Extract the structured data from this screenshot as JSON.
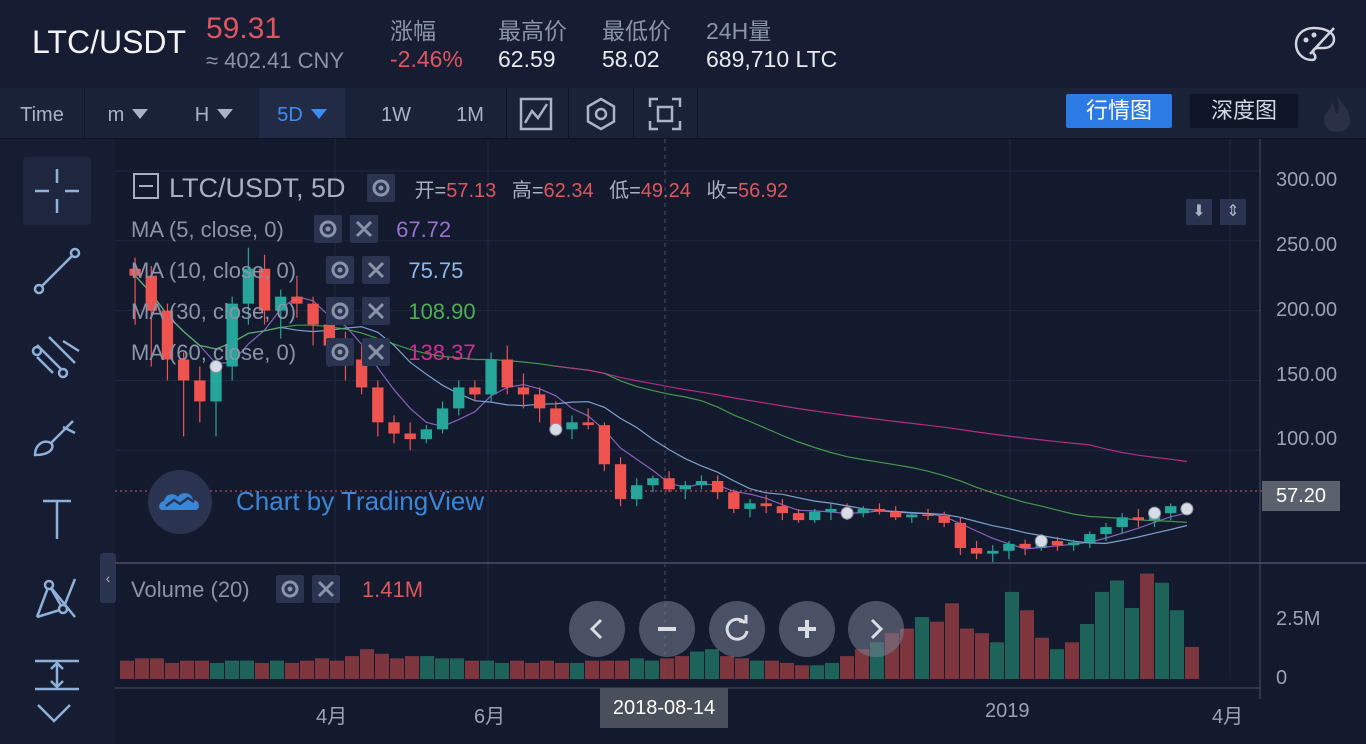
{
  "header": {
    "pair": "LTC/USDT",
    "price": "59.31",
    "price_cny": "≈ 402.41 CNY",
    "stats": [
      {
        "label": "涨幅",
        "value": "-2.46%"
      },
      {
        "label": "最高价",
        "value": "62.59"
      },
      {
        "label": "最低价",
        "value": "58.02"
      },
      {
        "label": "24H量",
        "value": "689,710 LTC"
      }
    ],
    "theme_icon": "palette-icon"
  },
  "toolbar": {
    "time_label": "Time",
    "intervals": [
      "m",
      "H",
      "5D",
      "1W",
      "1M"
    ],
    "active_interval": "5D",
    "icons": [
      "indicator-icon",
      "settings-hex-icon",
      "screenshot-icon"
    ],
    "market_tab": "行情图",
    "depth_tab": "深度图"
  },
  "legend": {
    "title": "LTC/USDT, 5D",
    "ohlc": [
      {
        "label": "开=",
        "value": "57.13"
      },
      {
        "label": "高=",
        "value": "62.34"
      },
      {
        "label": "低=",
        "value": "49.24"
      },
      {
        "label": "收=",
        "value": "56.92"
      }
    ],
    "ma": [
      {
        "label": "MA (5, close, 0)",
        "value": "67.72",
        "color": "#9b6fd1"
      },
      {
        "label": "MA (10, close, 0)",
        "value": "75.75",
        "color": "#8fb8e8"
      },
      {
        "label": "MA (30, close, 0)",
        "value": "108.90",
        "color": "#4caf50"
      },
      {
        "label": "MA (60, close, 0)",
        "value": "138.37",
        "color": "#d12f8f"
      }
    ],
    "volume": {
      "label": "Volume (20)",
      "value": "1.41M"
    }
  },
  "watermark": "Chart by TradingView",
  "price_axis": [
    "300.00",
    "250.00",
    "200.00",
    "150.00",
    "100.00"
  ],
  "current_price_tag": "57.20",
  "volume_axis": [
    "2.5M",
    "0"
  ],
  "time_axis": [
    "4月",
    "6月",
    "2019",
    "4月"
  ],
  "crosshair_date": "2018-08-14",
  "left_tools": [
    "crosshair-icon",
    "trend-line-icon",
    "pitchfork-icon",
    "brush-icon",
    "text-icon",
    "pattern-icon",
    "measure-icon"
  ],
  "nav_buttons": [
    "chevron-left-icon",
    "zoom-out-icon",
    "reset-icon",
    "zoom-in-icon",
    "chevron-right-icon"
  ],
  "chart_data": {
    "type": "candlestick",
    "title": "LTC/USDT, 5D",
    "ylim": [
      20,
      310
    ],
    "ohlc": [
      [
        230,
        238,
        190,
        225
      ],
      [
        225,
        232,
        160,
        200
      ],
      [
        200,
        205,
        150,
        165
      ],
      [
        165,
        170,
        110,
        150
      ],
      [
        150,
        160,
        120,
        135
      ],
      [
        135,
        165,
        110,
        160
      ],
      [
        160,
        210,
        150,
        205
      ],
      [
        205,
        245,
        190,
        230
      ],
      [
        230,
        240,
        190,
        200
      ],
      [
        200,
        215,
        180,
        210
      ],
      [
        210,
        225,
        195,
        205
      ],
      [
        205,
        210,
        175,
        190
      ],
      [
        190,
        195,
        160,
        175
      ],
      [
        175,
        185,
        150,
        165
      ],
      [
        165,
        175,
        140,
        145
      ],
      [
        145,
        150,
        110,
        120
      ],
      [
        120,
        125,
        105,
        112
      ],
      [
        112,
        120,
        100,
        108
      ],
      [
        108,
        118,
        105,
        115
      ],
      [
        115,
        135,
        112,
        130
      ],
      [
        130,
        150,
        125,
        145
      ],
      [
        145,
        150,
        135,
        140
      ],
      [
        140,
        170,
        135,
        165
      ],
      [
        165,
        175,
        140,
        145
      ],
      [
        145,
        155,
        130,
        140
      ],
      [
        140,
        145,
        120,
        130
      ],
      [
        130,
        135,
        110,
        115
      ],
      [
        115,
        125,
        108,
        120
      ],
      [
        120,
        130,
        115,
        118
      ],
      [
        118,
        120,
        85,
        90
      ],
      [
        90,
        95,
        60,
        65
      ],
      [
        65,
        80,
        60,
        75
      ],
      [
        75,
        82,
        70,
        80
      ],
      [
        80,
        85,
        70,
        72
      ],
      [
        72,
        78,
        65,
        75
      ],
      [
        75,
        82,
        72,
        78
      ],
      [
        78,
        82,
        65,
        70
      ],
      [
        70,
        72,
        55,
        58
      ],
      [
        58,
        65,
        52,
        62
      ],
      [
        62,
        68,
        55,
        60
      ],
      [
        60,
        65,
        50,
        55
      ],
      [
        55,
        58,
        48,
        50
      ],
      [
        50,
        58,
        48,
        56
      ],
      [
        56,
        62,
        50,
        58
      ],
      [
        58,
        62,
        50,
        55
      ],
      [
        55,
        60,
        52,
        58
      ],
      [
        58,
        62,
        54,
        56
      ],
      [
        56,
        60,
        50,
        52
      ],
      [
        52,
        56,
        48,
        54
      ],
      [
        54,
        58,
        50,
        53
      ],
      [
        53,
        56,
        45,
        48
      ],
      [
        48,
        52,
        25,
        30
      ],
      [
        30,
        35,
        22,
        26
      ],
      [
        26,
        32,
        20,
        28
      ],
      [
        28,
        35,
        22,
        33
      ],
      [
        33,
        36,
        25,
        30
      ],
      [
        30,
        40,
        28,
        35
      ],
      [
        35,
        38,
        28,
        32
      ],
      [
        32,
        36,
        28,
        34
      ],
      [
        34,
        42,
        30,
        40
      ],
      [
        40,
        48,
        35,
        45
      ],
      [
        45,
        55,
        40,
        52
      ],
      [
        52,
        58,
        45,
        50
      ],
      [
        50,
        58,
        45,
        55
      ],
      [
        55,
        62,
        50,
        60
      ],
      [
        60,
        62,
        55,
        58
      ]
    ],
    "volume": [
      0.8,
      0.9,
      0.9,
      0.7,
      0.8,
      0.8,
      0.7,
      0.8,
      0.8,
      0.7,
      0.8,
      0.7,
      0.8,
      0.9,
      0.8,
      1.0,
      1.3,
      1.1,
      0.9,
      1.0,
      1.0,
      0.9,
      0.9,
      0.8,
      0.8,
      0.7,
      0.8,
      0.7,
      0.8,
      0.7,
      0.7,
      0.8,
      0.8,
      0.8,
      0.9,
      0.8,
      0.9,
      1.0,
      1.2,
      1.3,
      1.0,
      0.9,
      0.8,
      0.8,
      0.7,
      0.6,
      0.6,
      0.7,
      1.0,
      1.3,
      1.6,
      2.0,
      2.2,
      2.7,
      2.5,
      3.3,
      2.2,
      2.0,
      1.6,
      3.8,
      3.0,
      1.8,
      1.3,
      1.6,
      2.4,
      3.8,
      4.3,
      3.1,
      4.6,
      4.2,
      3.0,
      1.4
    ]
  }
}
